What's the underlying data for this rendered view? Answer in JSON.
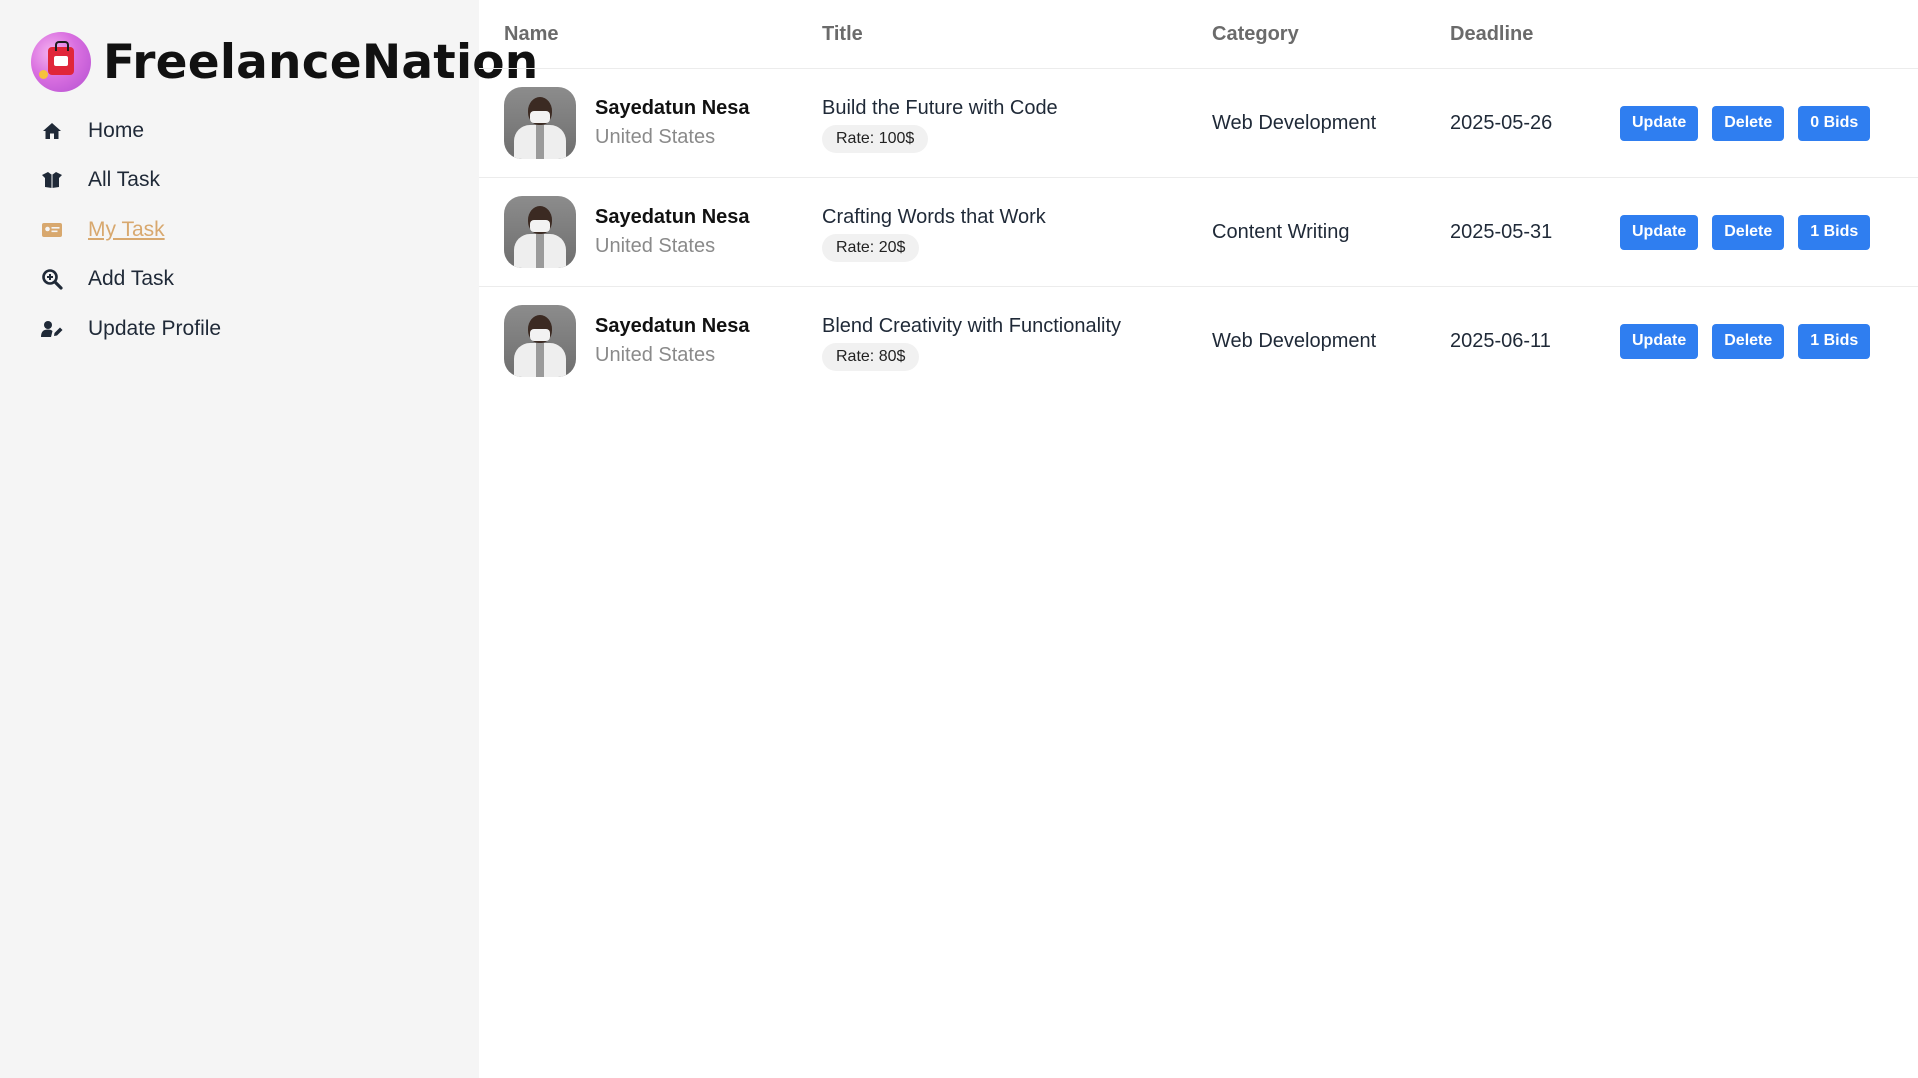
{
  "brand": {
    "name": "FreelanceNation",
    "logo_icon": "shopping-bag-logo"
  },
  "sidebar": {
    "items": [
      {
        "label": "Home",
        "icon": "home-icon",
        "active": false
      },
      {
        "label": "All Task",
        "icon": "box-open-icon",
        "active": false
      },
      {
        "label": "My Task",
        "icon": "id-card-icon",
        "active": true
      },
      {
        "label": "Add Task",
        "icon": "search-plus-icon",
        "active": false
      },
      {
        "label": "Update Profile",
        "icon": "user-edit-icon",
        "active": false
      }
    ]
  },
  "table": {
    "headers": {
      "name": "Name",
      "title": "Title",
      "category": "Category",
      "deadline": "Deadline"
    },
    "rows": [
      {
        "name": "Sayedatun Nesa",
        "country": "United States",
        "title": "Build the Future with Code",
        "rate": "Rate: 100$",
        "category": "Web Development",
        "deadline": "2025-05-26",
        "update_label": "Update",
        "delete_label": "Delete",
        "bids_label": "0 Bids"
      },
      {
        "name": "Sayedatun Nesa",
        "country": "United States",
        "title": "Crafting Words that Work",
        "rate": "Rate: 20$",
        "category": "Content Writing",
        "deadline": "2025-05-31",
        "update_label": "Update",
        "delete_label": "Delete",
        "bids_label": "1 Bids"
      },
      {
        "name": "Sayedatun Nesa",
        "country": "United States",
        "title": "Blend Creativity with Functionality",
        "rate": "Rate: 80$",
        "category": "Web Development",
        "deadline": "2025-06-11",
        "update_label": "Update",
        "delete_label": "Delete",
        "bids_label": "1 Bids"
      }
    ]
  },
  "colors": {
    "accent": "#2f7ef0",
    "active_nav": "#d8a86e",
    "sidebar_bg": "#f5f5f5"
  }
}
